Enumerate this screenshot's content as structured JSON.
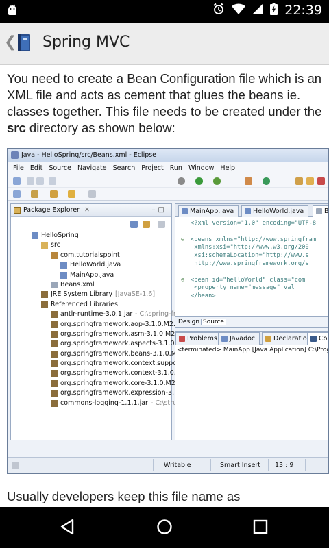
{
  "status_bar": {
    "time": "22:39"
  },
  "app_bar": {
    "back_glyph": "❮",
    "title": "Spring MVC",
    "icon": "book-icon"
  },
  "article": {
    "para1_before": "You need to create a Bean Configuration file which is an XML file and acts as cement that glues the beans ie. classes together. This file needs to be created under the ",
    "para1_bold": "src",
    "para1_after": " directory as shown below:",
    "para2": "Usually developers keep this file name as"
  },
  "eclipse": {
    "title": "Java - HelloSpring/src/Beans.xml - Eclipse",
    "menu": [
      "File",
      "Edit",
      "Source",
      "Navigate",
      "Search",
      "Project",
      "Run",
      "Window",
      "Help"
    ],
    "package_explorer": {
      "title": "Package Explorer",
      "close": "✕",
      "tree": [
        {
          "label": "HelloSpring",
          "extra": "",
          "indent": 0,
          "icon": "project"
        },
        {
          "label": "src",
          "extra": "",
          "indent": 1,
          "icon": "folder"
        },
        {
          "label": "com.tutorialspoint",
          "extra": "",
          "indent": 2,
          "icon": "package"
        },
        {
          "label": "HelloWorld.java",
          "extra": "",
          "indent": 3,
          "icon": "java"
        },
        {
          "label": "MainApp.java",
          "extra": "",
          "indent": 3,
          "icon": "java"
        },
        {
          "label": "Beans.xml",
          "extra": "",
          "indent": 2,
          "icon": "xml"
        },
        {
          "label": "JRE System Library",
          "extra": "[JavaSE-1.6]",
          "indent": 1,
          "icon": "lib"
        },
        {
          "label": "Referenced Libraries",
          "extra": "",
          "indent": 1,
          "icon": "lib"
        },
        {
          "label": "antlr-runtime-3.0.1.jar",
          "extra": "- C:\\spring-fram",
          "indent": 2,
          "icon": "jar"
        },
        {
          "label": "org.springframework.aop-3.1.0.M2.jar",
          "extra": "",
          "indent": 2,
          "icon": "jar"
        },
        {
          "label": "org.springframework.asm-3.1.0.M2.jar",
          "extra": "",
          "indent": 2,
          "icon": "jar"
        },
        {
          "label": "org.springframework.aspects-3.1.0.M2",
          "extra": "",
          "indent": 2,
          "icon": "jar"
        },
        {
          "label": "org.springframework.beans-3.1.0.M2.ja",
          "extra": "",
          "indent": 2,
          "icon": "jar"
        },
        {
          "label": "org.springframework.context.support-",
          "extra": "",
          "indent": 2,
          "icon": "jar"
        },
        {
          "label": "org.springframework.context-3.1.0.M2",
          "extra": "",
          "indent": 2,
          "icon": "jar"
        },
        {
          "label": "org.springframework.core-3.1.0.M2.jar",
          "extra": "",
          "indent": 2,
          "icon": "jar"
        },
        {
          "label": "org.springframework.expression-3.1.0.I",
          "extra": "",
          "indent": 2,
          "icon": "jar"
        },
        {
          "label": "commons-logging-1.1.1.jar",
          "extra": "- C:\\struts",
          "indent": 2,
          "icon": "jar"
        }
      ]
    },
    "editor": {
      "tabs": [
        "MainApp.java",
        "HelloWorld.java",
        "B"
      ],
      "code": [
        {
          "dot": "",
          "text": "<?xml version=\"1.0\" encoding=\"UTF-8"
        },
        {
          "dot": "",
          "text": ""
        },
        {
          "dot": "⊖",
          "text": "<beans xmlns=\"http://www.springfram"
        },
        {
          "dot": "",
          "text": "   xmlns:xsi=\"http://www.w3.org/200"
        },
        {
          "dot": "",
          "text": "   xsi:schemaLocation=\"http://www.s"
        },
        {
          "dot": "",
          "text": "   http://www.springframework.org/s"
        },
        {
          "dot": "",
          "text": ""
        },
        {
          "dot": "⊖",
          "text": "<bean id=\"helloWorld\" class=\"com"
        },
        {
          "dot": "",
          "text": "   <property name=\"message\" val"
        },
        {
          "dot": "",
          "text": "</bean>"
        }
      ],
      "bottom_tabs": [
        "Design",
        "Source"
      ]
    },
    "console": {
      "tabs": [
        "Problems",
        "Javadoc",
        "Declaration",
        "Cons"
      ],
      "line": "<terminated> MainApp [Java Application] C:\\Program"
    },
    "status": {
      "writable": "Writable",
      "insert_mode": "Smart Insert",
      "position": "13 : 9"
    }
  }
}
